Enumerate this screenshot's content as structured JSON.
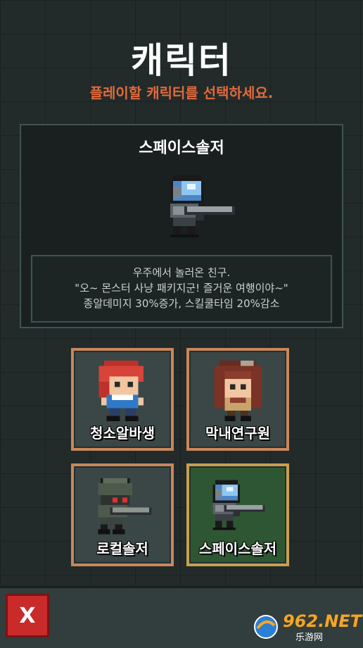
{
  "screen": {
    "title": "캐릭터",
    "subtitle": "플레이할 캐릭터를 선택하세요."
  },
  "detail": {
    "name": "스페이스솔저",
    "description": [
      "우주에서 놀러온 친구.",
      "\"오~ 몬스터 사냥 패키지군! 즐거운 여행이야~\"",
      "종알데미지 30%증가, 스킬쿨타임 20%감소"
    ]
  },
  "characters": [
    {
      "label": "청소알바생",
      "selected": false,
      "icon": "red-hair-girl-sprite"
    },
    {
      "label": "막내연구원",
      "selected": false,
      "icon": "goggles-researcher-sprite"
    },
    {
      "label": "로컬솔저",
      "selected": false,
      "icon": "helmet-soldier-sprite"
    },
    {
      "label": "스페이스솔저",
      "selected": true,
      "icon": "space-soldier-sprite"
    }
  ],
  "close_button": {
    "label": "X"
  },
  "watermark": {
    "brand": "962.NET",
    "sub": "乐游网"
  },
  "colors": {
    "accent": "#e06a3c",
    "card_border": "#c8875a",
    "selected_card": "#2e5632",
    "close": "#c92a2a"
  }
}
